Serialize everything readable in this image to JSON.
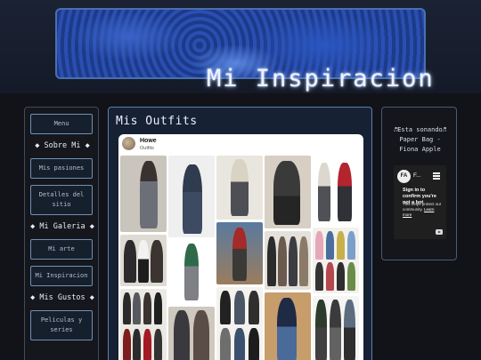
{
  "header": {
    "title": "Mi Inspiracion"
  },
  "sidebar": {
    "items": [
      {
        "type": "button",
        "label": "Menu"
      },
      {
        "type": "heading",
        "label": "◆ Sobre Mi ◆"
      },
      {
        "type": "button",
        "label": "Mis pasiones"
      },
      {
        "type": "button",
        "label": "Detalles del sitio"
      },
      {
        "type": "heading",
        "label": "◆ Mi Galeria ◆"
      },
      {
        "type": "button",
        "label": "Mi arte"
      },
      {
        "type": "button",
        "label": "Mi Inspiracion"
      },
      {
        "type": "heading",
        "label": "◆ Mis Gustos ◆"
      },
      {
        "type": "button",
        "label": "Peliculas y series"
      }
    ]
  },
  "main": {
    "title": "Mis Outfits",
    "pin": {
      "user": "Howe",
      "board": "Outfits"
    }
  },
  "now_playing": {
    "heading": "♬Esta sonando♬",
    "song": "Paper Bag -",
    "artist": "Fiona Apple",
    "widget": {
      "logo": "FA",
      "title": "F...",
      "message": "Sign in to confirm you're not a bot",
      "note": "This helps protect our community.",
      "link": "Learn more"
    }
  },
  "colors": {
    "accent": "#5a7fb0",
    "panel": "#172134",
    "banner": "#1e3c96"
  }
}
